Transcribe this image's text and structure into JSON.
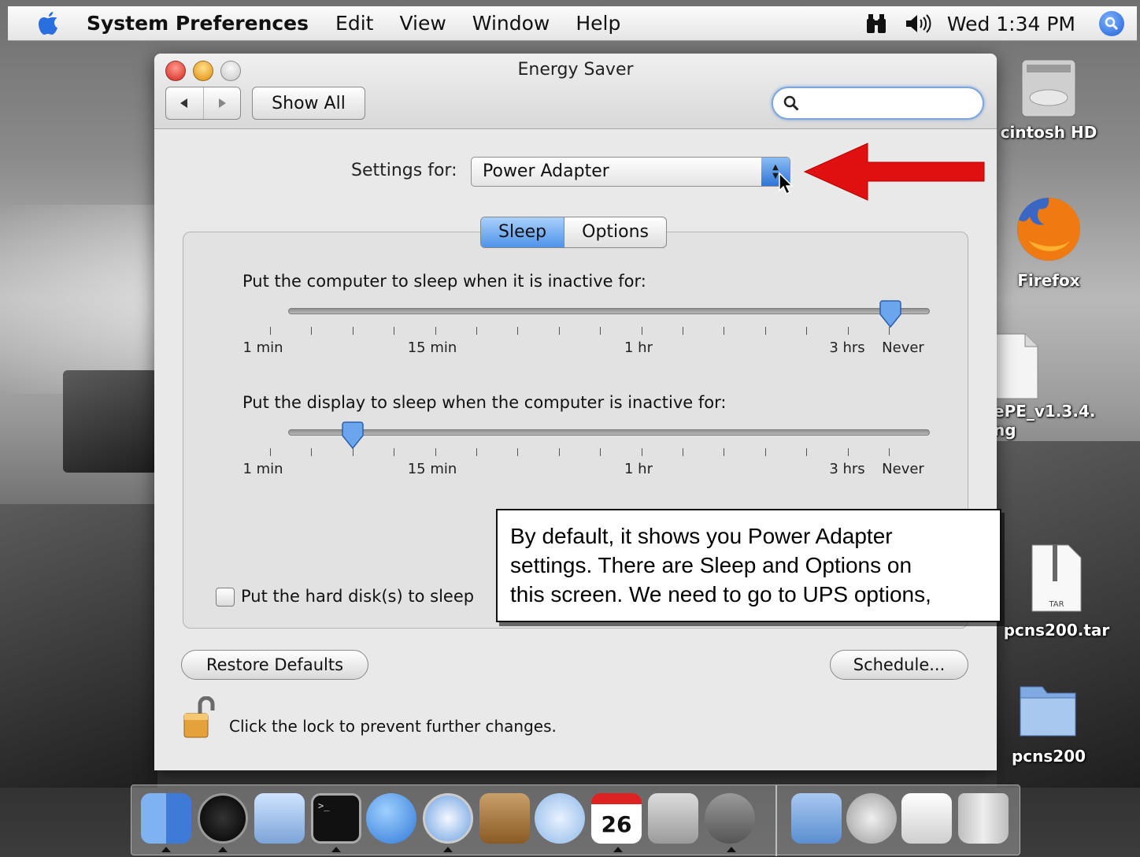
{
  "menubar": {
    "app_name": "System Preferences",
    "items": [
      "Edit",
      "View",
      "Window",
      "Help"
    ],
    "clock": "Wed 1:34 PM"
  },
  "window": {
    "title": "Energy Saver",
    "show_all_label": "Show All",
    "search_placeholder": "",
    "settings_for_label": "Settings for:",
    "settings_for_value": "Power Adapter",
    "tabs": [
      {
        "label": "Sleep",
        "active": true
      },
      {
        "label": "Options",
        "active": false
      }
    ],
    "computer_sleep": {
      "label": "Put the computer to sleep when it is inactive for:",
      "value": "Never",
      "tick_labels": [
        "1 min",
        "15 min",
        "1 hr",
        "3 hrs",
        "Never"
      ]
    },
    "display_sleep": {
      "label": "Put the display to sleep when the computer is inactive for:",
      "tick_labels": [
        "1 min",
        "15 min",
        "1 hr",
        "3 hrs",
        "Never"
      ]
    },
    "hard_disk_checkbox": {
      "label": "Put the hard disk(s) to sleep",
      "checked": false
    },
    "restore_defaults_label": "Restore Defaults",
    "schedule_label": "Schedule...",
    "lock_text": "Click the lock to prevent further changes."
  },
  "annotation": {
    "text_lines": [
      "By default, it shows you Power Adapter",
      "settings.  There are Sleep and Options on",
      "this screen.  We need to go to UPS options,"
    ],
    "arrow_color": "#e01010"
  },
  "desktop_icons": [
    {
      "label": "cintosh HD",
      "icon": "hard-drive-icon"
    },
    {
      "label": "Firefox",
      "icon": "firefox-icon"
    },
    {
      "label": "ePE_v1.3.4.",
      "label2": "ng",
      "icon": "document-icon"
    },
    {
      "label": "pcns200.tar",
      "icon": "tar-archive-icon",
      "badge": "TAR"
    },
    {
      "label": "pcns200",
      "icon": "folder-icon"
    }
  ],
  "dock": {
    "calendar_day": "26",
    "items": [
      "finder-icon",
      "dashboard-icon",
      "mail-icon",
      "terminal-icon",
      "ichat-icon",
      "safari-icon",
      "address-book-icon",
      "itunes-icon",
      "ical-icon",
      "system-preferences-icon",
      "network-utility-icon",
      "applications-folder-icon",
      "mail-server-icon",
      "preview-icon",
      "trash-icon"
    ]
  }
}
